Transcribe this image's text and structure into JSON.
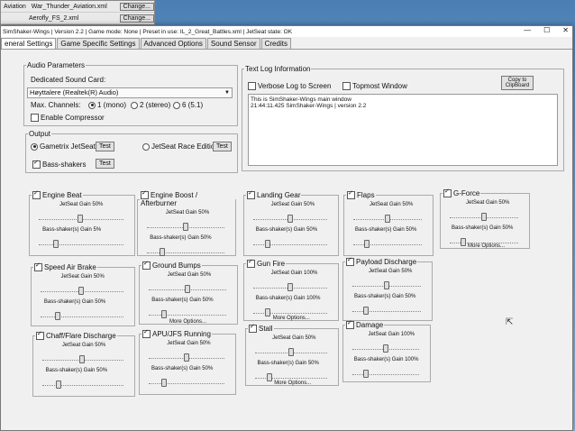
{
  "background_windows": [
    {
      "name": "Aviation",
      "file": "War_Thunder_Aviation.xml",
      "button": "Change..."
    },
    {
      "name": "",
      "file": "Aerofly_FS_2.xml",
      "button": "Change..."
    }
  ],
  "window": {
    "title": "SimShaker-Wings | Version 2.2 | Game mode: None | Preset in use: IL_2_Great_Battles.xml | JetSeat state: OK",
    "controls": [
      "—",
      "☐",
      "✕"
    ]
  },
  "tabs": [
    "eneral Settings",
    "Game Specific Settings",
    "Advanced Options",
    "Sound Sensor",
    "Credits"
  ],
  "audio": {
    "legend": "Audio Parameters",
    "sound_card_label": "Dedicated Sound Card:",
    "sound_card_value": "Høyttalere (Realtek(R) Audio)",
    "channels_label": "Max. Channels:",
    "channels": [
      "1 (mono)",
      "2 (stereo)",
      "6 (5.1)"
    ],
    "compressor": "Enable Compressor"
  },
  "output": {
    "legend": "Output",
    "gametrix": "Gametrix JetSeat",
    "jetseat_race": "JetSeat Race Edition",
    "bass": "Bass-shakers",
    "test": "Test"
  },
  "textlog": {
    "legend": "Text Log Information",
    "verbose": "Verbose Log to Screen",
    "topmost": "Topmost Window",
    "copy": "Copy to ClipBoard",
    "lines": [
      "This is SimShaker-Wings main window",
      "21:44:11.425 SimShaker-Wings | version 2.2"
    ]
  },
  "effects": [
    {
      "title": "Engine Beat",
      "g1": "JetSeat Gain 50%",
      "g2": "Bass-shaker(s) Gain 5%",
      "more": ""
    },
    {
      "title": "Engine Boost / Afterburner",
      "g1": "JetSeat Gain 50%",
      "g2": "Bass-shaker(s) Gain 50%",
      "more": ""
    },
    {
      "title": "Landing Gear",
      "g1": "JetSeat Gain 50%",
      "g2": "Bass-shaker(s) Gain 50%",
      "more": ""
    },
    {
      "title": "Flaps",
      "g1": "JetSeat Gain 50%",
      "g2": "Bass-shaker(s) Gain 50%",
      "more": ""
    },
    {
      "title": "G-Force",
      "g1": "JetSeat Gain 50%",
      "g2": "Bass-shaker(s) Gain 50%",
      "more": "More Options..."
    },
    {
      "title": "Speed Air Brake",
      "g1": "JetSeat Gain 50%",
      "g2": "Bass-shaker(s) Gain 50%",
      "more": ""
    },
    {
      "title": "Ground Bumps",
      "g1": "JetSeat Gain 50%",
      "g2": "Bass-shaker(s) Gain 50%",
      "more": "More Options..."
    },
    {
      "title": "Gun Fire",
      "g1": "JetSeat Gain 100%",
      "g2": "Bass-shaker(s) Gain 100%",
      "more": "More Options..."
    },
    {
      "title": "Payload Discharge",
      "g1": "JetSeat Gain 50%",
      "g2": "Bass-shaker(s) Gain 50%",
      "more": ""
    },
    {
      "title": "Chaff/Flare Discharge",
      "g1": "JetSeat Gain 50%",
      "g2": "Bass-shaker(s) Gain 50%",
      "more": ""
    },
    {
      "title": "APU/JFS Running",
      "g1": "JetSeat Gain 50%",
      "g2": "Bass-shaker(s) Gain 50%",
      "more": ""
    },
    {
      "title": "Stall",
      "g1": "JetSeat Gain 50%",
      "g2": "Bass-shaker(s) Gain 50%",
      "more": "More Options..."
    },
    {
      "title": "Damage",
      "g1": "JetSeat Gain 100%",
      "g2": "Bass-shaker(s) Gain 100%",
      "more": ""
    }
  ]
}
